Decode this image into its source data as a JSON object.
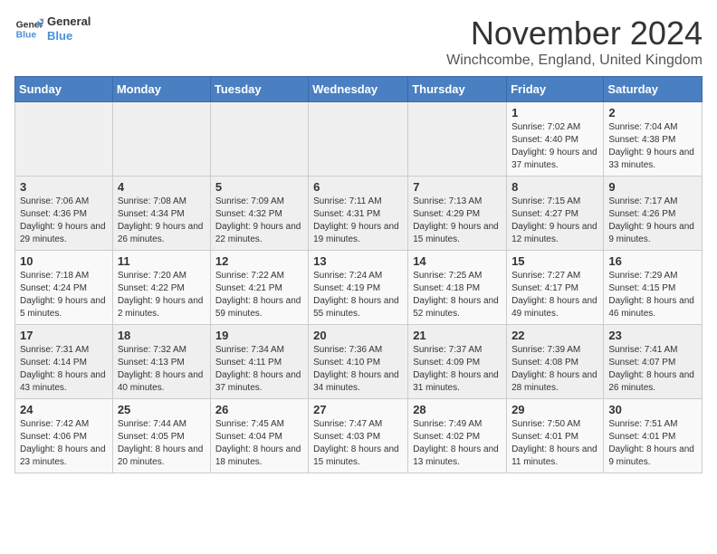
{
  "logo": {
    "line1": "General",
    "line2": "Blue"
  },
  "title": "November 2024",
  "location": "Winchcombe, England, United Kingdom",
  "weekdays": [
    "Sunday",
    "Monday",
    "Tuesday",
    "Wednesday",
    "Thursday",
    "Friday",
    "Saturday"
  ],
  "weeks": [
    [
      {
        "day": "",
        "info": ""
      },
      {
        "day": "",
        "info": ""
      },
      {
        "day": "",
        "info": ""
      },
      {
        "day": "",
        "info": ""
      },
      {
        "day": "",
        "info": ""
      },
      {
        "day": "1",
        "info": "Sunrise: 7:02 AM\nSunset: 4:40 PM\nDaylight: 9 hours and 37 minutes."
      },
      {
        "day": "2",
        "info": "Sunrise: 7:04 AM\nSunset: 4:38 PM\nDaylight: 9 hours and 33 minutes."
      }
    ],
    [
      {
        "day": "3",
        "info": "Sunrise: 7:06 AM\nSunset: 4:36 PM\nDaylight: 9 hours and 29 minutes."
      },
      {
        "day": "4",
        "info": "Sunrise: 7:08 AM\nSunset: 4:34 PM\nDaylight: 9 hours and 26 minutes."
      },
      {
        "day": "5",
        "info": "Sunrise: 7:09 AM\nSunset: 4:32 PM\nDaylight: 9 hours and 22 minutes."
      },
      {
        "day": "6",
        "info": "Sunrise: 7:11 AM\nSunset: 4:31 PM\nDaylight: 9 hours and 19 minutes."
      },
      {
        "day": "7",
        "info": "Sunrise: 7:13 AM\nSunset: 4:29 PM\nDaylight: 9 hours and 15 minutes."
      },
      {
        "day": "8",
        "info": "Sunrise: 7:15 AM\nSunset: 4:27 PM\nDaylight: 9 hours and 12 minutes."
      },
      {
        "day": "9",
        "info": "Sunrise: 7:17 AM\nSunset: 4:26 PM\nDaylight: 9 hours and 9 minutes."
      }
    ],
    [
      {
        "day": "10",
        "info": "Sunrise: 7:18 AM\nSunset: 4:24 PM\nDaylight: 9 hours and 5 minutes."
      },
      {
        "day": "11",
        "info": "Sunrise: 7:20 AM\nSunset: 4:22 PM\nDaylight: 9 hours and 2 minutes."
      },
      {
        "day": "12",
        "info": "Sunrise: 7:22 AM\nSunset: 4:21 PM\nDaylight: 8 hours and 59 minutes."
      },
      {
        "day": "13",
        "info": "Sunrise: 7:24 AM\nSunset: 4:19 PM\nDaylight: 8 hours and 55 minutes."
      },
      {
        "day": "14",
        "info": "Sunrise: 7:25 AM\nSunset: 4:18 PM\nDaylight: 8 hours and 52 minutes."
      },
      {
        "day": "15",
        "info": "Sunrise: 7:27 AM\nSunset: 4:17 PM\nDaylight: 8 hours and 49 minutes."
      },
      {
        "day": "16",
        "info": "Sunrise: 7:29 AM\nSunset: 4:15 PM\nDaylight: 8 hours and 46 minutes."
      }
    ],
    [
      {
        "day": "17",
        "info": "Sunrise: 7:31 AM\nSunset: 4:14 PM\nDaylight: 8 hours and 43 minutes."
      },
      {
        "day": "18",
        "info": "Sunrise: 7:32 AM\nSunset: 4:13 PM\nDaylight: 8 hours and 40 minutes."
      },
      {
        "day": "19",
        "info": "Sunrise: 7:34 AM\nSunset: 4:11 PM\nDaylight: 8 hours and 37 minutes."
      },
      {
        "day": "20",
        "info": "Sunrise: 7:36 AM\nSunset: 4:10 PM\nDaylight: 8 hours and 34 minutes."
      },
      {
        "day": "21",
        "info": "Sunrise: 7:37 AM\nSunset: 4:09 PM\nDaylight: 8 hours and 31 minutes."
      },
      {
        "day": "22",
        "info": "Sunrise: 7:39 AM\nSunset: 4:08 PM\nDaylight: 8 hours and 28 minutes."
      },
      {
        "day": "23",
        "info": "Sunrise: 7:41 AM\nSunset: 4:07 PM\nDaylight: 8 hours and 26 minutes."
      }
    ],
    [
      {
        "day": "24",
        "info": "Sunrise: 7:42 AM\nSunset: 4:06 PM\nDaylight: 8 hours and 23 minutes."
      },
      {
        "day": "25",
        "info": "Sunrise: 7:44 AM\nSunset: 4:05 PM\nDaylight: 8 hours and 20 minutes."
      },
      {
        "day": "26",
        "info": "Sunrise: 7:45 AM\nSunset: 4:04 PM\nDaylight: 8 hours and 18 minutes."
      },
      {
        "day": "27",
        "info": "Sunrise: 7:47 AM\nSunset: 4:03 PM\nDaylight: 8 hours and 15 minutes."
      },
      {
        "day": "28",
        "info": "Sunrise: 7:49 AM\nSunset: 4:02 PM\nDaylight: 8 hours and 13 minutes."
      },
      {
        "day": "29",
        "info": "Sunrise: 7:50 AM\nSunset: 4:01 PM\nDaylight: 8 hours and 11 minutes."
      },
      {
        "day": "30",
        "info": "Sunrise: 7:51 AM\nSunset: 4:01 PM\nDaylight: 8 hours and 9 minutes."
      }
    ]
  ]
}
